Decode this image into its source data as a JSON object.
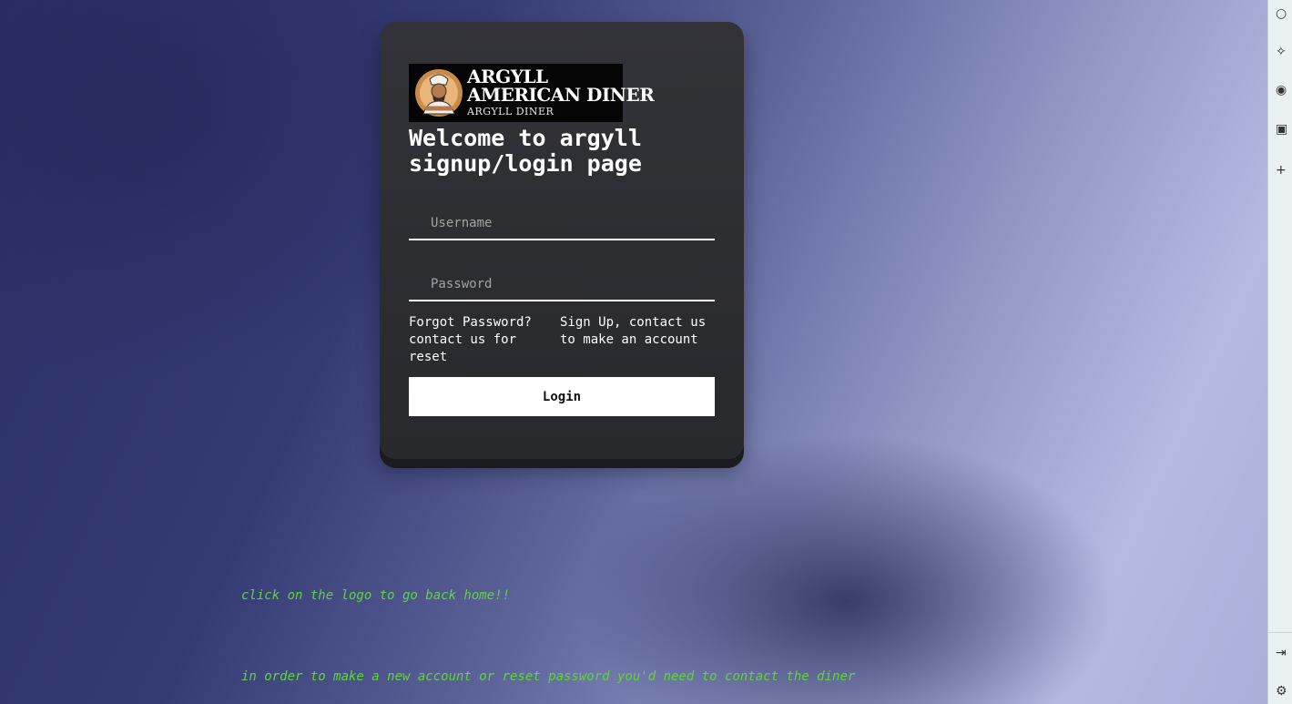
{
  "logo": {
    "line1": "ARGYLL",
    "line2": "AMERICAN DINER",
    "line3": "ARGYLL DINER",
    "icon": "chef-mascot-icon"
  },
  "title": "Welcome to argyll signup/login page",
  "username": {
    "placeholder": "Username",
    "value": ""
  },
  "password": {
    "placeholder": "Password",
    "value": ""
  },
  "forgot_text": "Forgot Password? contact us for reset",
  "signup_text": "Sign Up, contact us to make an account",
  "login_label": "Login",
  "notes": {
    "logo_hint": "click on the logo to go back home!!",
    "contact_hint": "in order to make a new account or reset password you'd need to contact the diner"
  },
  "side_icons": [
    "search-icon",
    "sparkle-icon",
    "shield-icon",
    "outlook-icon",
    "plus-icon",
    "expand-icon",
    "settings-icon"
  ],
  "colors": {
    "accent_green": "#5fd63a",
    "card": "#2c2d31"
  }
}
